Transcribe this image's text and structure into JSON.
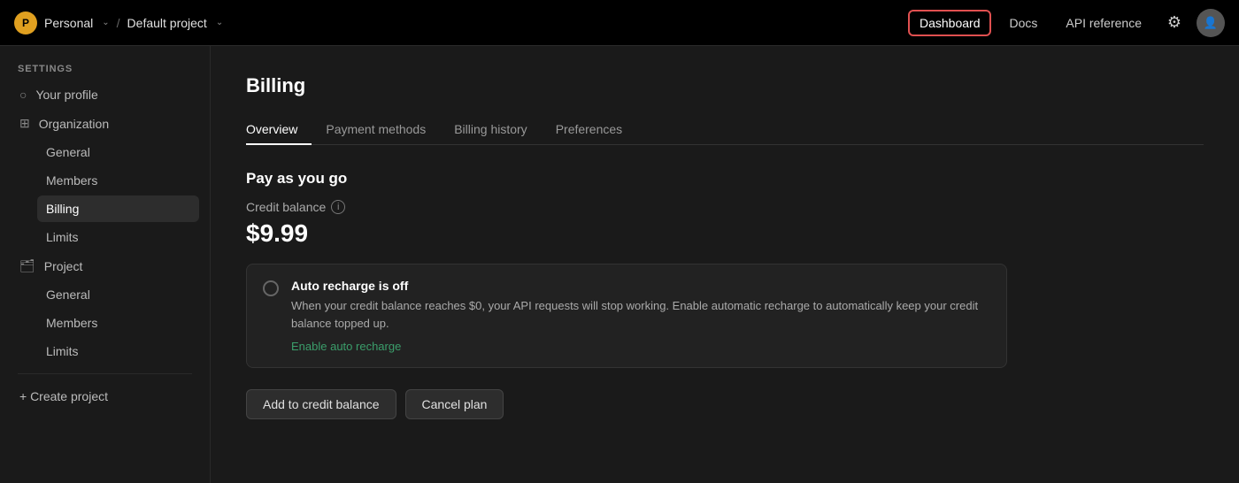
{
  "topnav": {
    "org_avatar_letter": "P",
    "org_name": "Personal",
    "project_name": "Default project",
    "nav_links": [
      {
        "label": "Dashboard",
        "active": true
      },
      {
        "label": "Docs",
        "active": false
      },
      {
        "label": "API reference",
        "active": false
      }
    ]
  },
  "sidebar": {
    "settings_label": "SETTINGS",
    "items": [
      {
        "label": "Your profile",
        "icon": "👤",
        "active": false,
        "sub": false
      },
      {
        "label": "Organization",
        "icon": "🏢",
        "active": false,
        "sub": false,
        "group": true
      },
      {
        "label": "General",
        "active": false,
        "sub": true
      },
      {
        "label": "Members",
        "active": false,
        "sub": true
      },
      {
        "label": "Billing",
        "active": true,
        "sub": true
      },
      {
        "label": "Limits",
        "active": false,
        "sub": true
      },
      {
        "label": "Project",
        "icon": "🗂",
        "active": false,
        "sub": false,
        "group": true
      },
      {
        "label": "General",
        "active": false,
        "sub": true
      },
      {
        "label": "Members",
        "active": false,
        "sub": true
      },
      {
        "label": "Limits",
        "active": false,
        "sub": true
      }
    ],
    "create_project_label": "+ Create project"
  },
  "main": {
    "page_title": "Billing",
    "tabs": [
      {
        "label": "Overview",
        "active": true
      },
      {
        "label": "Payment methods",
        "active": false
      },
      {
        "label": "Billing history",
        "active": false
      },
      {
        "label": "Preferences",
        "active": false
      }
    ],
    "section_title": "Pay as you go",
    "credit_balance_label": "Credit balance",
    "credit_amount": "$9.99",
    "recharge": {
      "title": "Auto recharge is off",
      "description": "When your credit balance reaches $0, your API requests will stop working. Enable automatic recharge to automatically keep your credit balance topped up.",
      "link_label": "Enable auto recharge"
    },
    "buttons": [
      {
        "label": "Add to credit balance"
      },
      {
        "label": "Cancel plan"
      }
    ]
  }
}
